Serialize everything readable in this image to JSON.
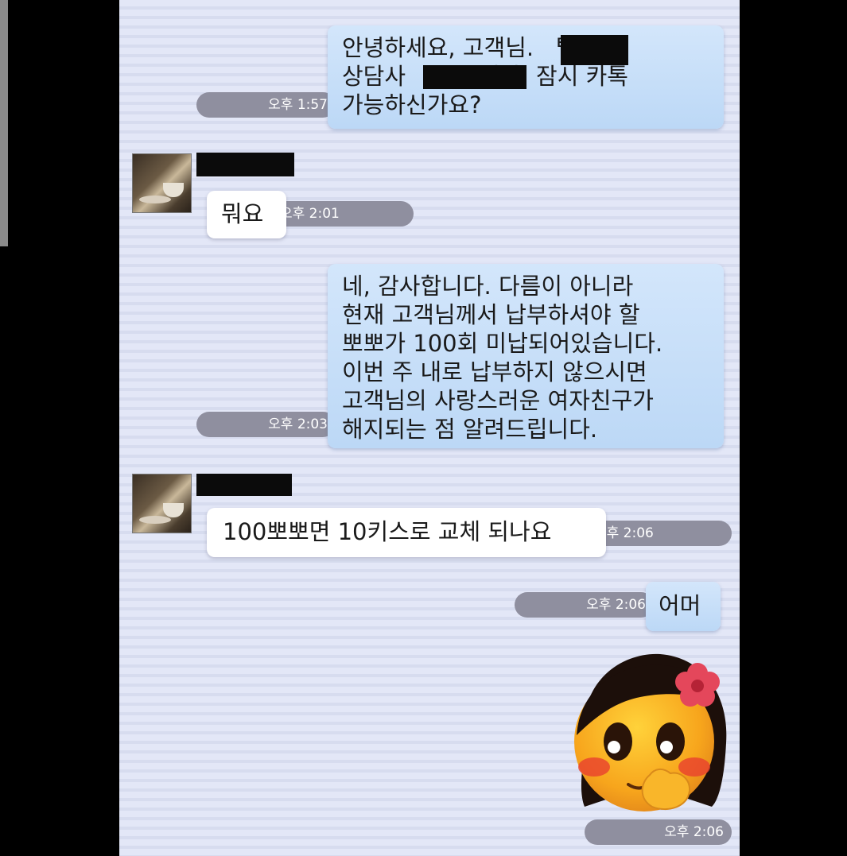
{
  "messages": [
    {
      "id": "m1",
      "sender": "me",
      "text": "안녕하세요, 고객님.   텔레콤\n상담사          니다. 잠시 카톡\n가능하신가요?",
      "time": "오후 1:57"
    },
    {
      "id": "m2",
      "sender": "them",
      "text": "뭐요",
      "time": "오후 2:01"
    },
    {
      "id": "m3",
      "sender": "me",
      "text": "네, 감사합니다. 다름이 아니라\n현재 고객님께서 납부하셔야 할\n뽀뽀가 100회 미납되어있습니다.\n이번 주 내로 납부하지 않으시면\n고객님의 사랑스러운 여자친구가\n해지되는 점 알려드립니다.",
      "time": "오후 2:03"
    },
    {
      "id": "m4",
      "sender": "them",
      "text": "100뽀뽀면 10키스로 교체 되나요",
      "time": "오후 2:06"
    },
    {
      "id": "m5",
      "sender": "me",
      "text": "어머",
      "time": "오후 2:06"
    },
    {
      "id": "m6",
      "sender": "me",
      "sticker": "blushing-girl-emoji-sticker",
      "time": "오후 2:06"
    }
  ],
  "colors": {
    "my_bubble": "#c7dff8",
    "their_bubble": "#ffffff",
    "time_pill": "#8f8f9f",
    "chat_background": "#dfe3f4"
  }
}
